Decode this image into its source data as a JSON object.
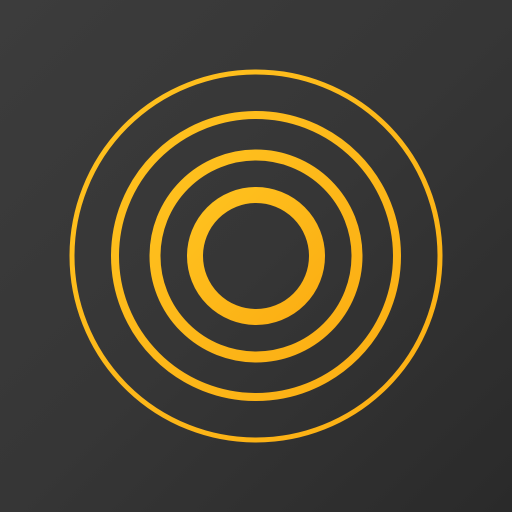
{
  "icon": {
    "name": "concentric-rings-icon",
    "ring_count": 4
  },
  "colors": {
    "background": "#383838",
    "background_dark": "#2a2a2a",
    "ring": "#ffb81c",
    "ring_inner": "#ffb200"
  }
}
